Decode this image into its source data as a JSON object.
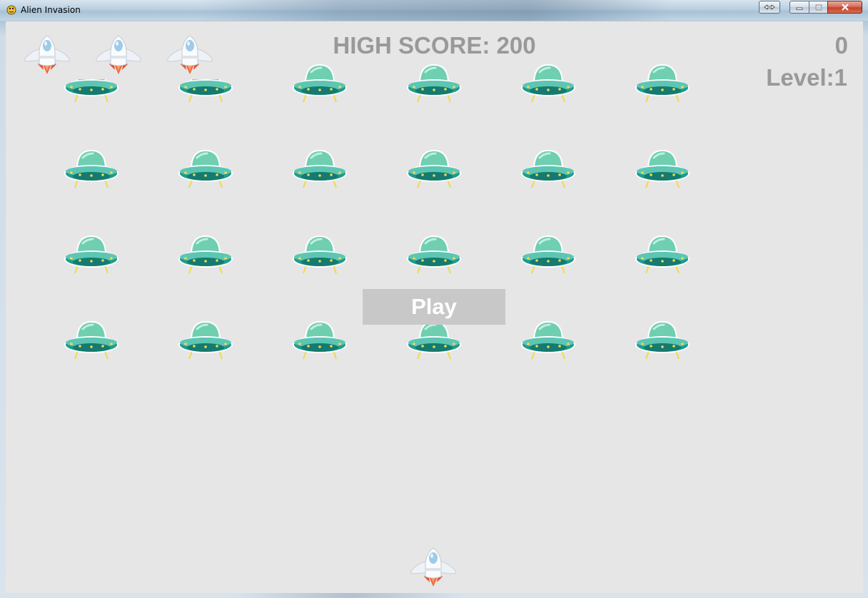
{
  "window": {
    "title": "Alien Invasion",
    "app_icon": "pygame-snake-icon"
  },
  "window_controls": [
    "resize-icon",
    "minimize-icon",
    "maximize-icon",
    "close-icon"
  ],
  "hud": {
    "high_score": "HIGH SCORE: 200",
    "score": "0",
    "level": "Level:1",
    "lives_remaining": 3
  },
  "fleet": {
    "rows": 4,
    "columns": 6,
    "icon": "ufo-icon"
  },
  "play_button": {
    "label": "Play"
  },
  "colors": {
    "background": "#e6e6e6",
    "hud_text": "#999999",
    "play_button_bg": "#c8c8c8",
    "play_button_text": "#ffffff",
    "ufo_dome": "#6fcfb0",
    "ufo_body": "#1f9b8f",
    "ship_flame": "#f0643c"
  }
}
